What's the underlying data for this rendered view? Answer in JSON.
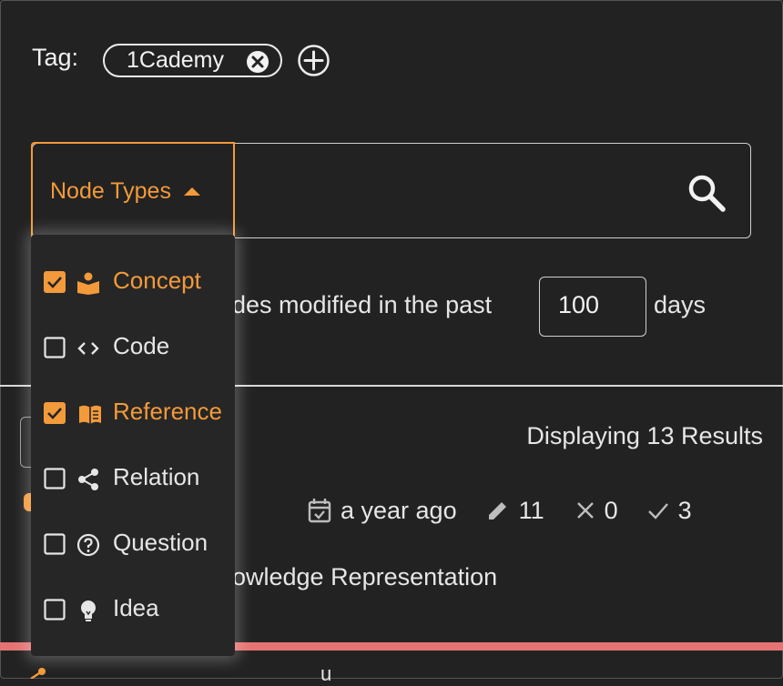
{
  "tag": {
    "label": "Tag:",
    "chip_text": "1Cademy"
  },
  "search": {
    "node_types_label": "Node Types",
    "value": ""
  },
  "filter": {
    "modified_text": "des modified in the past",
    "days_value": "100",
    "days_label": "days"
  },
  "results": {
    "count_text": "Displaying 13 Results",
    "item": {
      "date": "a year ago",
      "edits": "11",
      "downvotes": "0",
      "upvotes": "3",
      "title_visible": "owledge Representation"
    },
    "bottom_text_fragment": "u"
  },
  "dropdown": {
    "items": [
      {
        "label": "Concept",
        "checked": true,
        "icon": "concept-icon"
      },
      {
        "label": "Code",
        "checked": false,
        "icon": "code-icon"
      },
      {
        "label": "Reference",
        "checked": true,
        "icon": "reference-icon"
      },
      {
        "label": "Relation",
        "checked": false,
        "icon": "relation-icon"
      },
      {
        "label": "Question",
        "checked": false,
        "icon": "question-icon"
      },
      {
        "label": "Idea",
        "checked": false,
        "icon": "idea-icon"
      }
    ]
  },
  "colors": {
    "accent": "#f39a3b",
    "background": "#222222",
    "text": "#e6e6e6",
    "divider_red": "#e57373"
  }
}
